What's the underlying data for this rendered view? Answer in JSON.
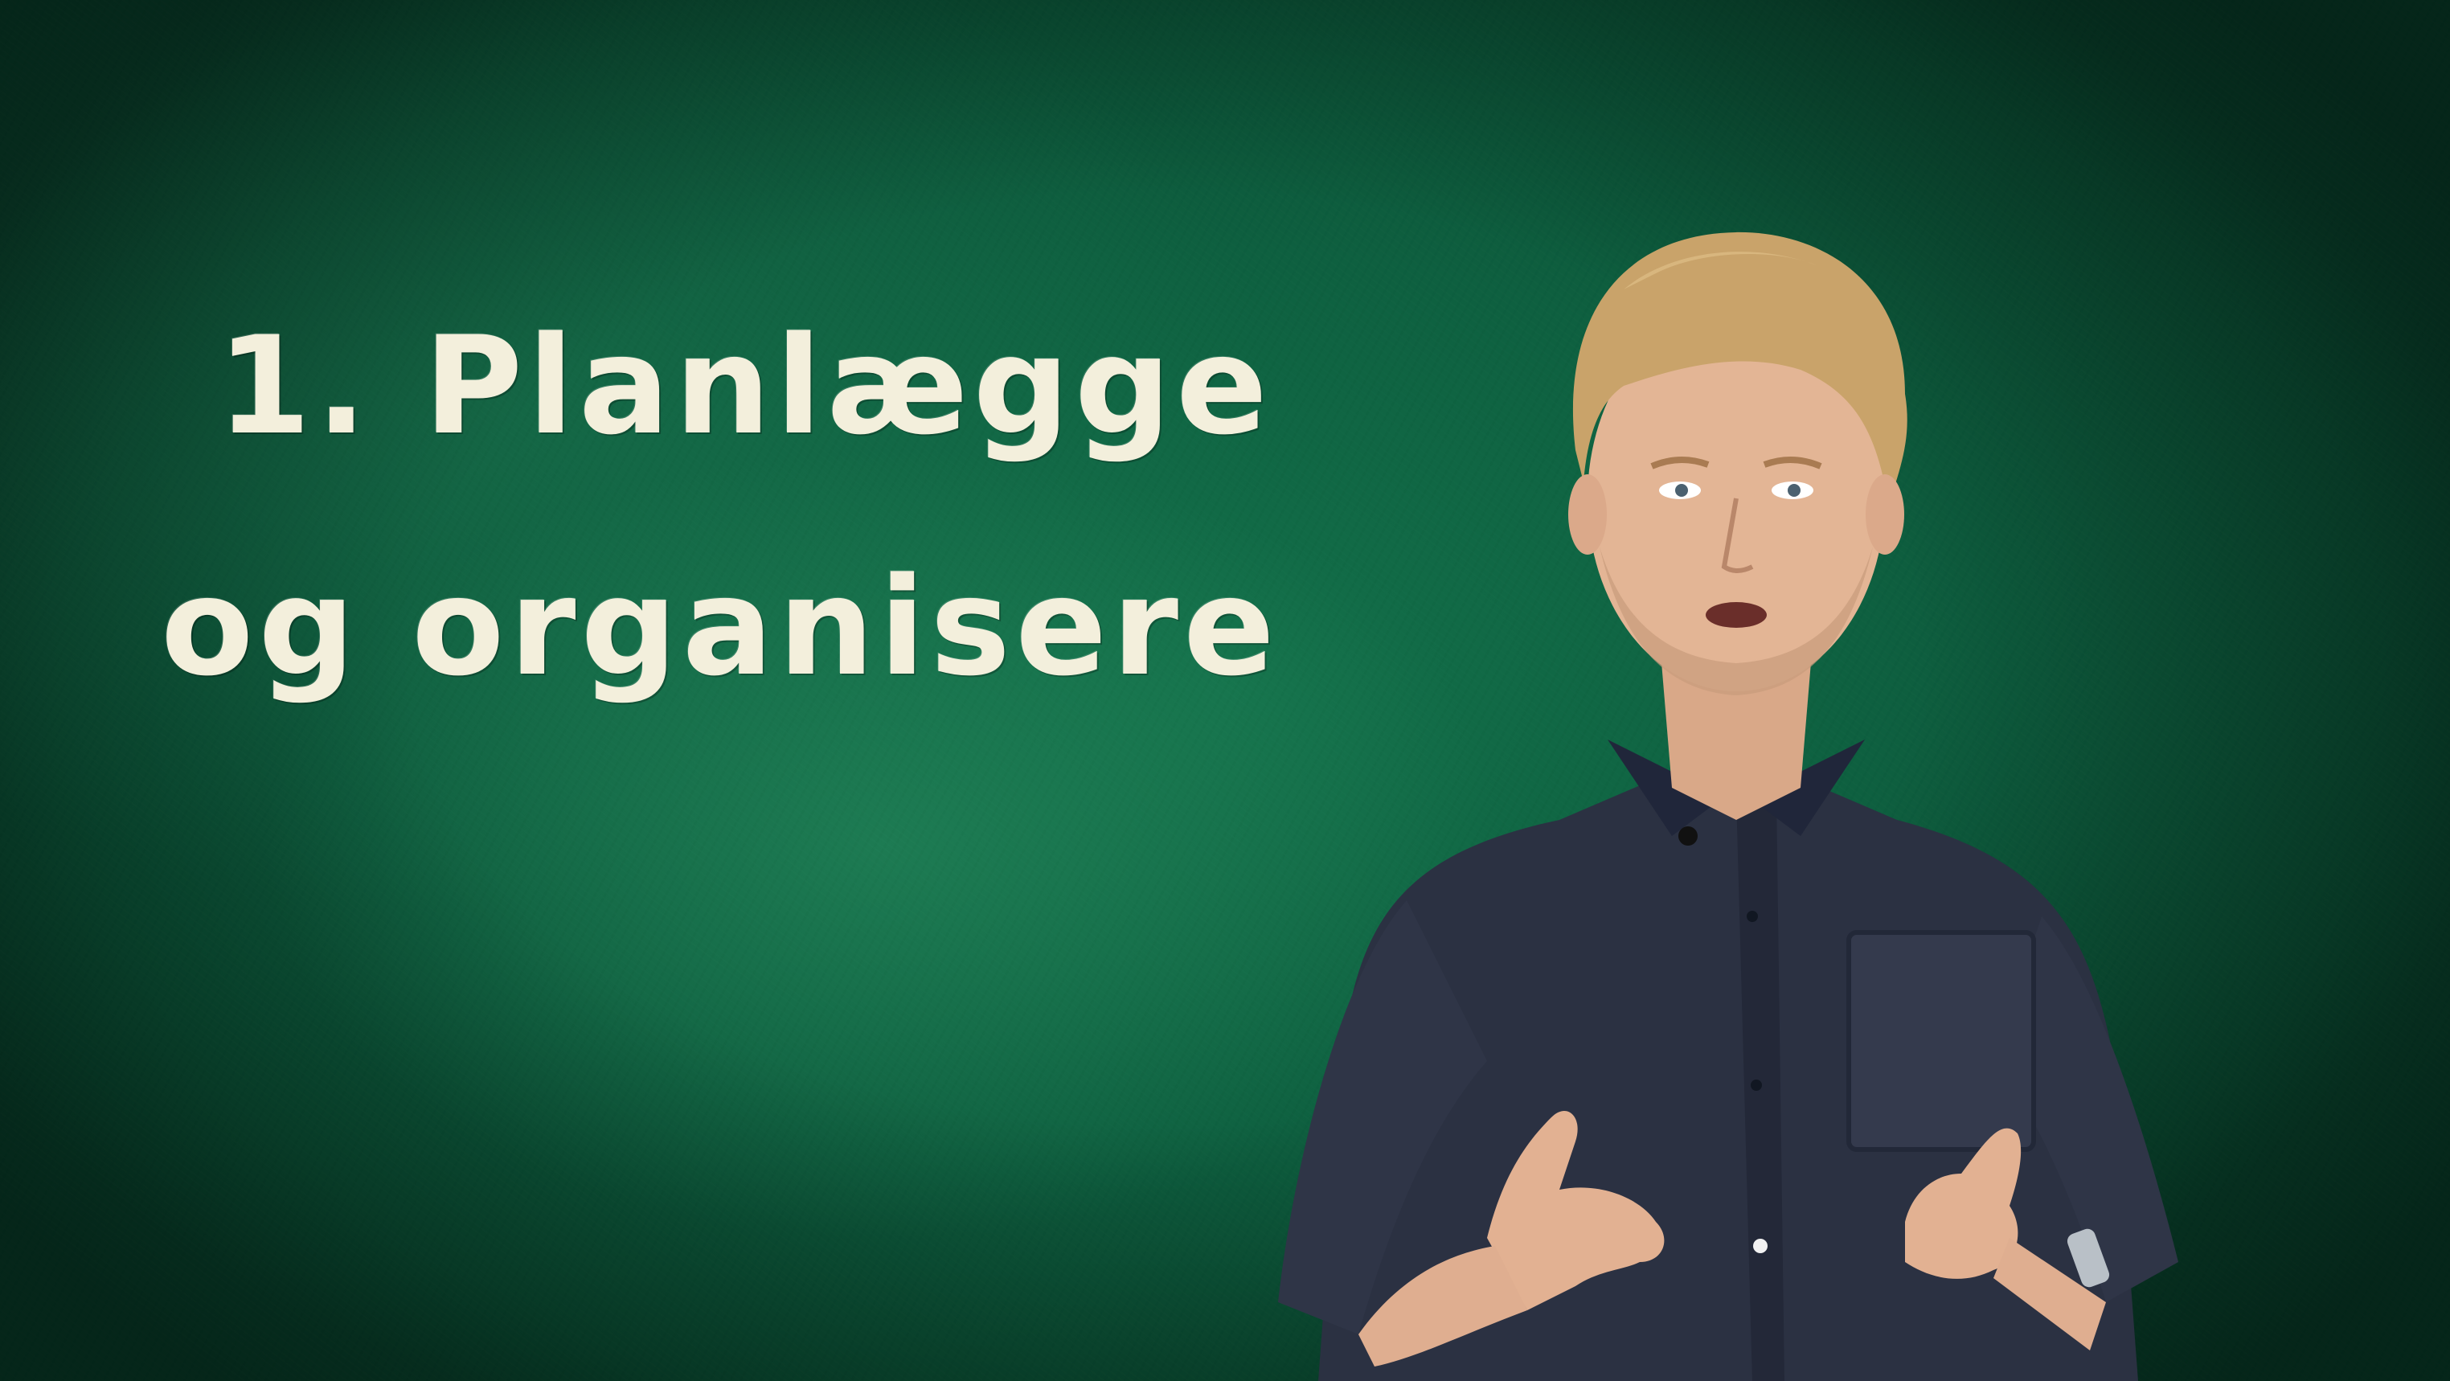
{
  "headline": {
    "line1": "1. Planlægge",
    "line2": "og organisere"
  },
  "colors": {
    "chalkboard": "#0e6040",
    "chalk_text": "#f3efdc",
    "shirt": "#2a3040",
    "hair": "#c9a36a",
    "skin": "#e3b595"
  },
  "icons": {
    "presenter": "person-illustration"
  }
}
